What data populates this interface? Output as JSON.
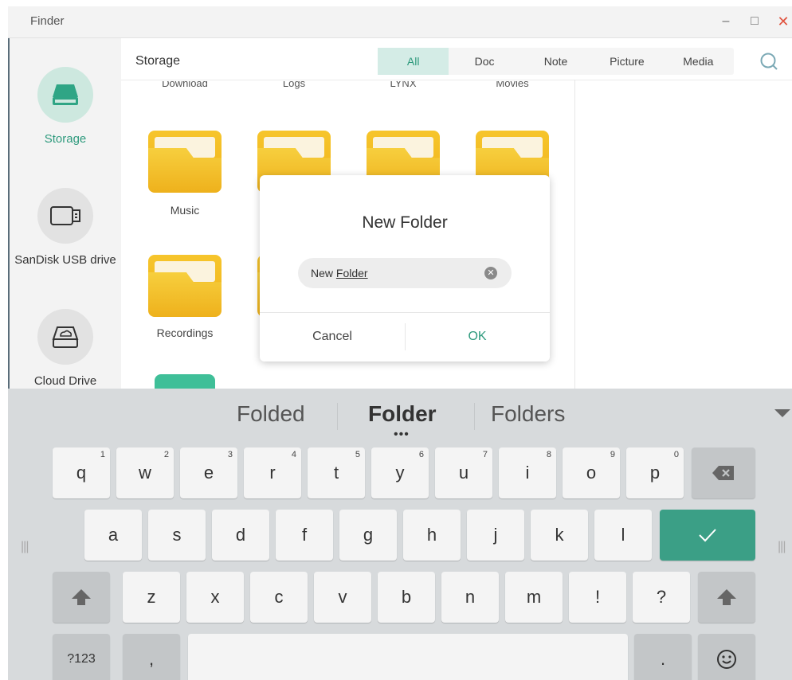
{
  "window": {
    "title": "Finder",
    "minimize": "–",
    "maximize": "□",
    "close": "✕"
  },
  "sidebar": {
    "items": [
      {
        "label": "Storage",
        "icon": "drive-icon",
        "active": true
      },
      {
        "label": "SanDisk USB drive",
        "icon": "usb-drive-icon",
        "active": false
      },
      {
        "label": "Cloud Drive",
        "icon": "cloud-drive-icon",
        "active": false
      }
    ]
  },
  "header": {
    "title": "Storage",
    "search_icon": "search-icon"
  },
  "filters": [
    {
      "label": "All",
      "active": true
    },
    {
      "label": "Doc",
      "active": false
    },
    {
      "label": "Note",
      "active": false
    },
    {
      "label": "Picture",
      "active": false
    },
    {
      "label": "Media",
      "active": false
    }
  ],
  "cut_labels": [
    "Download",
    "Logs",
    "LYNX",
    "Movies"
  ],
  "folders": [
    {
      "label": "Music"
    },
    {
      "label": ""
    },
    {
      "label": ""
    },
    {
      "label": ""
    },
    {
      "label": "Recordings"
    },
    {
      "label": ""
    }
  ],
  "dialog": {
    "title": "New Folder",
    "input_prefix": "New ",
    "input_word": "Folder",
    "cancel": "Cancel",
    "ok": "OK"
  },
  "keyboard": {
    "suggestions": [
      "Folded",
      "Folder",
      "Folders"
    ],
    "more": "•••",
    "row1": [
      {
        "k": "q",
        "h": "1"
      },
      {
        "k": "w",
        "h": "2"
      },
      {
        "k": "e",
        "h": "3"
      },
      {
        "k": "r",
        "h": "4"
      },
      {
        "k": "t",
        "h": "5"
      },
      {
        "k": "y",
        "h": "6"
      },
      {
        "k": "u",
        "h": "7"
      },
      {
        "k": "i",
        "h": "8"
      },
      {
        "k": "o",
        "h": "9"
      },
      {
        "k": "p",
        "h": "0"
      }
    ],
    "row2": [
      "a",
      "s",
      "d",
      "f",
      "g",
      "h",
      "j",
      "k",
      "l"
    ],
    "row3": [
      "z",
      "x",
      "c",
      "v",
      "b",
      "n",
      "m",
      "!",
      "?"
    ],
    "numbers_key": "?123",
    "comma_key": ",",
    "period_key": ".",
    "backspace_icon": "backspace-icon",
    "enter_icon": "checkmark-icon",
    "shift_icon": "shift-icon",
    "emoji_icon": "emoji-icon"
  },
  "colors": {
    "accent": "#2e9a7d",
    "folder": "#f5c12a",
    "enter": "#3b9f86"
  }
}
